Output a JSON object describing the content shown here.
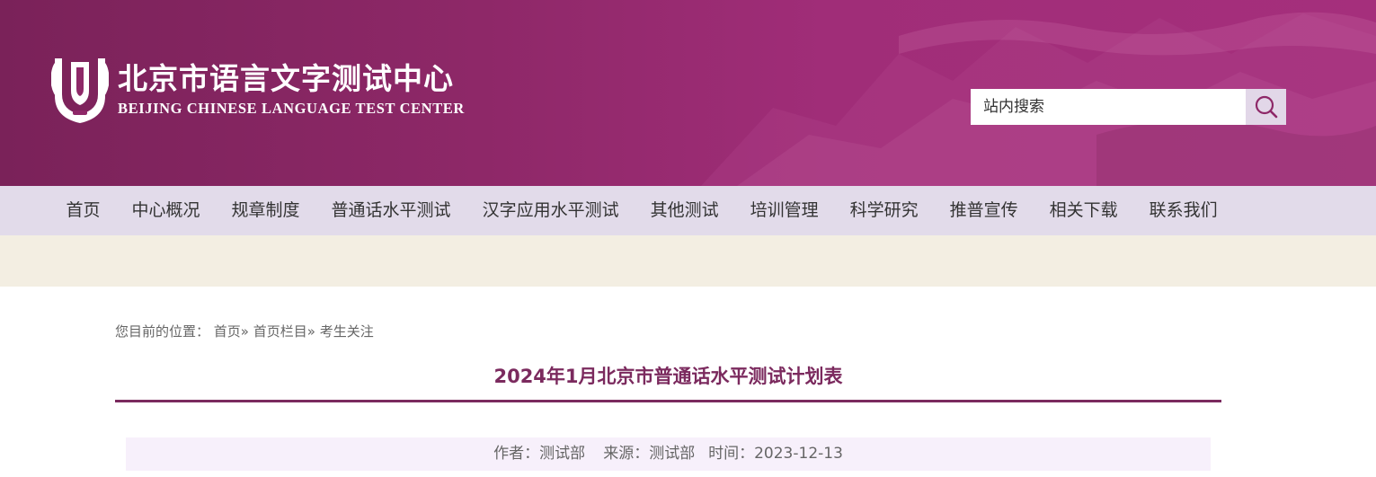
{
  "header": {
    "logo_cn": "北京市语言文字测试中心",
    "logo_en": "BEIJING CHINESE LANGUAGE TEST CENTER",
    "search_placeholder": "站内搜索",
    "search_icon": "search-icon"
  },
  "nav": {
    "items": [
      {
        "label": "首页"
      },
      {
        "label": "中心概况"
      },
      {
        "label": "规章制度"
      },
      {
        "label": "普通话水平测试"
      },
      {
        "label": "汉字应用水平测试"
      },
      {
        "label": "其他测试"
      },
      {
        "label": "培训管理"
      },
      {
        "label": "科学研究"
      },
      {
        "label": "推普宣传"
      },
      {
        "label": "相关下载"
      },
      {
        "label": "联系我们"
      }
    ]
  },
  "breadcrumb": {
    "prefix": "您目前的位置：",
    "items": [
      "首页»",
      "首页栏目»",
      "考生关注"
    ]
  },
  "article": {
    "title": "2024年1月北京市普通话水平测试计划表",
    "author_label": "作者：测试部",
    "source_label": "来源：测试部",
    "date_label": "时间：2023-12-13"
  },
  "colors": {
    "header_bg": "#8e2868",
    "nav_bg": "#e2dbea",
    "strip_bg": "#f3eee2",
    "title_color": "#7b2a5e",
    "meta_bg": "#f7f0fb"
  }
}
